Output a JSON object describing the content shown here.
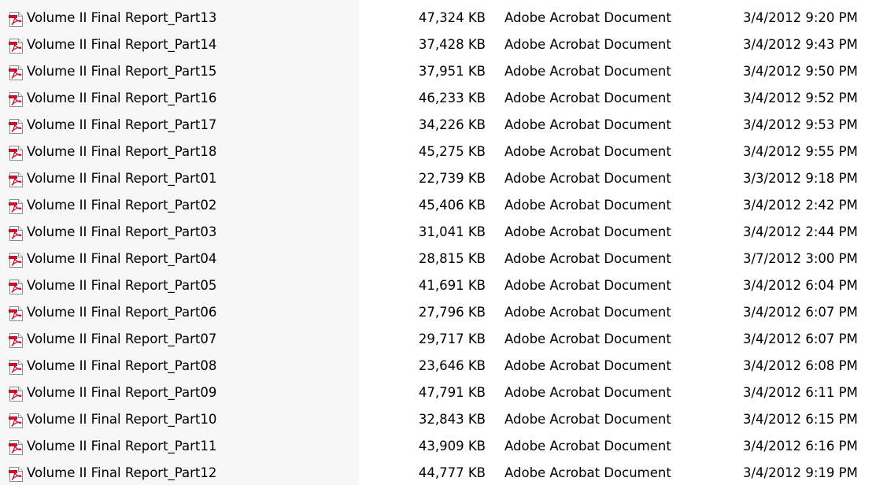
{
  "file_list": {
    "rows": [
      {
        "name": "Volume II Final Report_Part13",
        "size": "47,324 KB",
        "type": "Adobe Acrobat Document",
        "date": "3/4/2012 9:20 PM",
        "icon": "pdf-icon"
      },
      {
        "name": "Volume II Final Report_Part14",
        "size": "37,428 KB",
        "type": "Adobe Acrobat Document",
        "date": "3/4/2012 9:43 PM",
        "icon": "pdf-icon"
      },
      {
        "name": "Volume II Final Report_Part15",
        "size": "37,951 KB",
        "type": "Adobe Acrobat Document",
        "date": "3/4/2012 9:50 PM",
        "icon": "pdf-icon"
      },
      {
        "name": "Volume II Final Report_Part16",
        "size": "46,233 KB",
        "type": "Adobe Acrobat Document",
        "date": "3/4/2012 9:52 PM",
        "icon": "pdf-icon"
      },
      {
        "name": "Volume II Final Report_Part17",
        "size": "34,226 KB",
        "type": "Adobe Acrobat Document",
        "date": "3/4/2012 9:53 PM",
        "icon": "pdf-icon"
      },
      {
        "name": "Volume II Final Report_Part18",
        "size": "45,275 KB",
        "type": "Adobe Acrobat Document",
        "date": "3/4/2012 9:55 PM",
        "icon": "pdf-icon"
      },
      {
        "name": "Volume II Final Report_Part01",
        "size": "22,739 KB",
        "type": "Adobe Acrobat Document",
        "date": "3/3/2012 9:18 PM",
        "icon": "pdf-icon"
      },
      {
        "name": "Volume II Final Report_Part02",
        "size": "45,406 KB",
        "type": "Adobe Acrobat Document",
        "date": "3/4/2012 2:42 PM",
        "icon": "pdf-icon"
      },
      {
        "name": "Volume II Final Report_Part03",
        "size": "31,041 KB",
        "type": "Adobe Acrobat Document",
        "date": "3/4/2012 2:44 PM",
        "icon": "pdf-icon"
      },
      {
        "name": "Volume II Final Report_Part04",
        "size": "28,815 KB",
        "type": "Adobe Acrobat Document",
        "date": "3/7/2012 3:00 PM",
        "icon": "pdf-icon"
      },
      {
        "name": "Volume II Final Report_Part05",
        "size": "41,691 KB",
        "type": "Adobe Acrobat Document",
        "date": "3/4/2012 6:04 PM",
        "icon": "pdf-icon"
      },
      {
        "name": "Volume II Final Report_Part06",
        "size": "27,796 KB",
        "type": "Adobe Acrobat Document",
        "date": "3/4/2012 6:07 PM",
        "icon": "pdf-icon"
      },
      {
        "name": "Volume II Final Report_Part07",
        "size": "29,717 KB",
        "type": "Adobe Acrobat Document",
        "date": "3/4/2012 6:07 PM",
        "icon": "pdf-icon"
      },
      {
        "name": "Volume II Final Report_Part08",
        "size": "23,646 KB",
        "type": "Adobe Acrobat Document",
        "date": "3/4/2012 6:08 PM",
        "icon": "pdf-icon"
      },
      {
        "name": "Volume II Final Report_Part09",
        "size": "47,791 KB",
        "type": "Adobe Acrobat Document",
        "date": "3/4/2012 6:11 PM",
        "icon": "pdf-icon"
      },
      {
        "name": "Volume II Final Report_Part10",
        "size": "32,843 KB",
        "type": "Adobe Acrobat Document",
        "date": "3/4/2012 6:15 PM",
        "icon": "pdf-icon"
      },
      {
        "name": "Volume II Final Report_Part11",
        "size": "43,909 KB",
        "type": "Adobe Acrobat Document",
        "date": "3/4/2012 6:16 PM",
        "icon": "pdf-icon"
      },
      {
        "name": "Volume II Final Report_Part12",
        "size": "44,777 KB",
        "type": "Adobe Acrobat Document",
        "date": "3/4/2012 9:19 PM",
        "icon": "pdf-icon"
      }
    ]
  }
}
